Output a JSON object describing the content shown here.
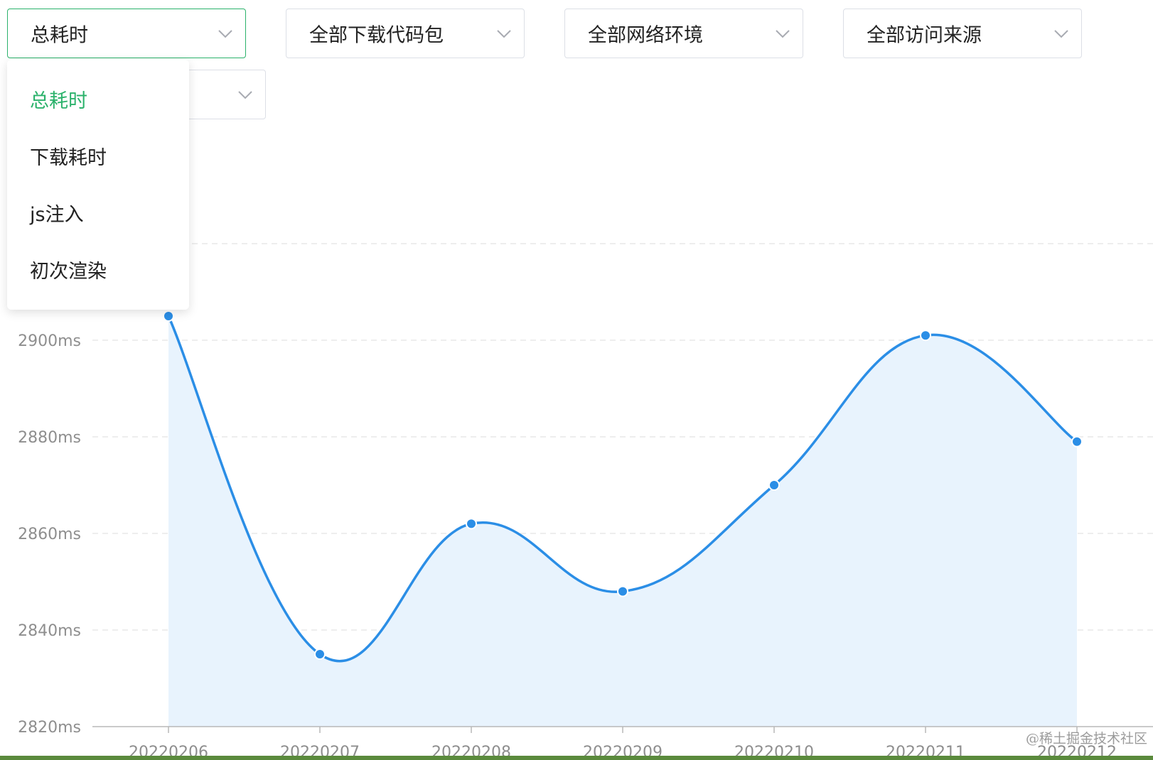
{
  "filters": {
    "metric": "总耗时",
    "package": "全部下载代码包",
    "network": "全部网络环境",
    "source": "全部访问来源",
    "fifth": ""
  },
  "dropdown": {
    "options": [
      "总耗时",
      "下载耗时",
      "js注入",
      "初次渲染"
    ],
    "selected_index": 0
  },
  "watermark": "@稀土掘金技术社区",
  "colors": {
    "line": "#2b8ee6",
    "area": "#e8f3fd",
    "active_border": "#2bb26b",
    "selected_option": "#2bb26b",
    "grid": "#e8e8e8",
    "axis_text": "#8e8e8e"
  },
  "chart_data": {
    "type": "area",
    "smooth": true,
    "x": [
      "20220206",
      "20220207",
      "20220208",
      "20220209",
      "20220210",
      "20220211",
      "20220212"
    ],
    "values": [
      2905,
      2835,
      2862,
      2848,
      2870,
      2901,
      2879
    ],
    "y_ticks": [
      2820,
      2840,
      2860,
      2880,
      2900
    ],
    "y_tick_labels": [
      "2820ms",
      "2840ms",
      "2860ms",
      "2880ms",
      "2900ms"
    ],
    "ylim": [
      2820,
      2920
    ],
    "grid": true
  }
}
